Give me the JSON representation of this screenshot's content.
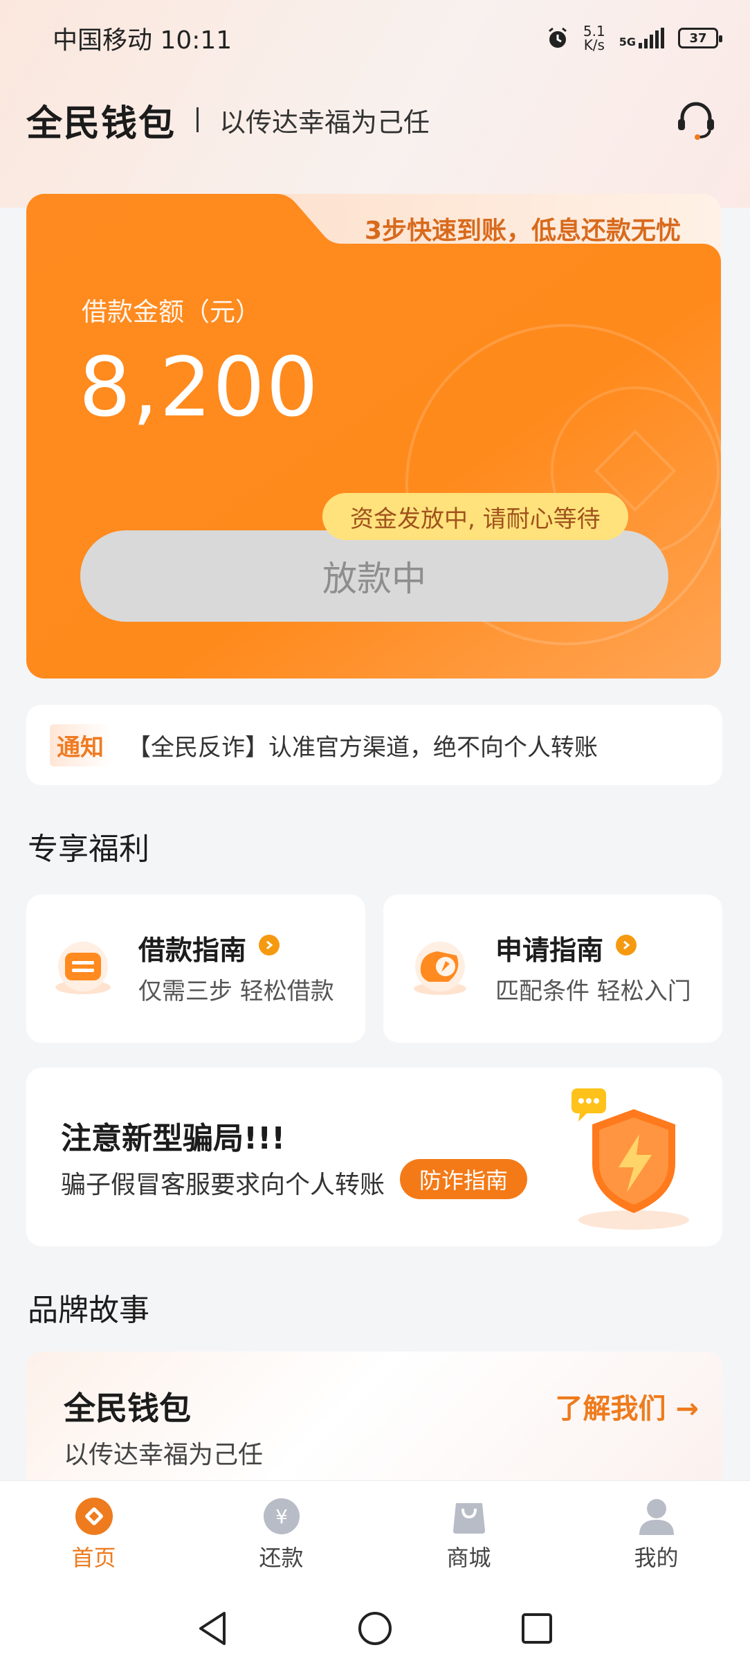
{
  "status_bar": {
    "carrier": "中国移动",
    "time": "10:11",
    "net_speed_value": "5.1",
    "net_speed_unit": "K/s",
    "network": "5G",
    "battery": "37",
    "icons": [
      "alarm-icon",
      "signal-icon",
      "battery-icon"
    ]
  },
  "header": {
    "brand": "全民钱包",
    "slogan": "以传达幸福为己任",
    "support_icon": "headset-icon"
  },
  "loan_card": {
    "tab_text": "3步快速到账，低息还款无忧",
    "label": "借款金额（元）",
    "amount": "8,200",
    "tip": "资金发放中, 请耐心等待",
    "button_label": "放款中"
  },
  "notice": {
    "tag": "通知",
    "text": "【全民反诈】认准官方渠道，绝不向个人转账"
  },
  "benefits": {
    "section_title": "专享福利",
    "items": [
      {
        "title": "借款指南",
        "subtitle": "仅需三步 轻松借款",
        "icon": "loan-guide-icon"
      },
      {
        "title": "申请指南",
        "subtitle": "匹配条件 轻松入门",
        "icon": "apply-guide-icon"
      }
    ]
  },
  "fraud_alert": {
    "title": "注意新型骗局!!!",
    "text": "骗子假冒客服要求向个人转账",
    "button_label": "防诈指南",
    "icon": "shield-icon"
  },
  "brand_story": {
    "section_title": "品牌故事",
    "title": "全民钱包",
    "subtitle": "以传达幸福为己任",
    "link_label": "了解我们 →"
  },
  "tabbar": {
    "active_color": "#ee7b1d",
    "items": [
      {
        "label": "首页",
        "icon": "home-icon",
        "active": true
      },
      {
        "label": "还款",
        "icon": "repay-icon",
        "active": false
      },
      {
        "label": "商城",
        "icon": "shop-icon",
        "active": false
      },
      {
        "label": "我的",
        "icon": "profile-icon",
        "active": false
      }
    ]
  },
  "colors": {
    "accent": "#f47a17",
    "card_orange": "#ff8a1f",
    "tip_yellow": "#ffe27c"
  }
}
